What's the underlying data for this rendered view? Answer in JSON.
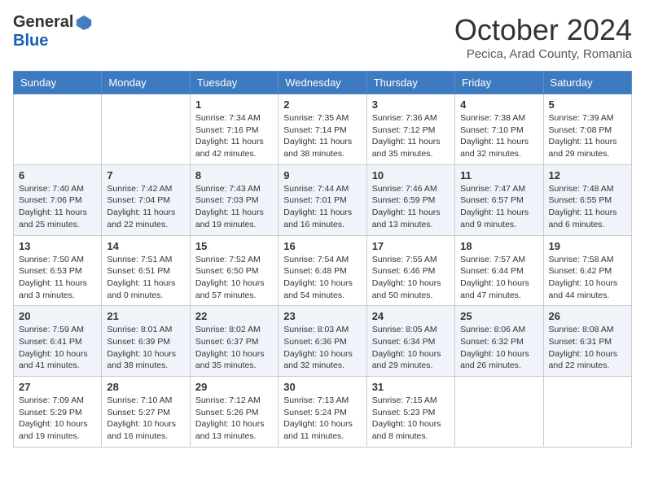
{
  "header": {
    "logo": {
      "general": "General",
      "blue": "Blue"
    },
    "title": "October 2024",
    "subtitle": "Pecica, Arad County, Romania"
  },
  "days_of_week": [
    "Sunday",
    "Monday",
    "Tuesday",
    "Wednesday",
    "Thursday",
    "Friday",
    "Saturday"
  ],
  "weeks": [
    [
      {
        "day": null,
        "sunrise": null,
        "sunset": null,
        "daylight": null
      },
      {
        "day": null,
        "sunrise": null,
        "sunset": null,
        "daylight": null
      },
      {
        "day": "1",
        "sunrise": "Sunrise: 7:34 AM",
        "sunset": "Sunset: 7:16 PM",
        "daylight": "Daylight: 11 hours and 42 minutes."
      },
      {
        "day": "2",
        "sunrise": "Sunrise: 7:35 AM",
        "sunset": "Sunset: 7:14 PM",
        "daylight": "Daylight: 11 hours and 38 minutes."
      },
      {
        "day": "3",
        "sunrise": "Sunrise: 7:36 AM",
        "sunset": "Sunset: 7:12 PM",
        "daylight": "Daylight: 11 hours and 35 minutes."
      },
      {
        "day": "4",
        "sunrise": "Sunrise: 7:38 AM",
        "sunset": "Sunset: 7:10 PM",
        "daylight": "Daylight: 11 hours and 32 minutes."
      },
      {
        "day": "5",
        "sunrise": "Sunrise: 7:39 AM",
        "sunset": "Sunset: 7:08 PM",
        "daylight": "Daylight: 11 hours and 29 minutes."
      }
    ],
    [
      {
        "day": "6",
        "sunrise": "Sunrise: 7:40 AM",
        "sunset": "Sunset: 7:06 PM",
        "daylight": "Daylight: 11 hours and 25 minutes."
      },
      {
        "day": "7",
        "sunrise": "Sunrise: 7:42 AM",
        "sunset": "Sunset: 7:04 PM",
        "daylight": "Daylight: 11 hours and 22 minutes."
      },
      {
        "day": "8",
        "sunrise": "Sunrise: 7:43 AM",
        "sunset": "Sunset: 7:03 PM",
        "daylight": "Daylight: 11 hours and 19 minutes."
      },
      {
        "day": "9",
        "sunrise": "Sunrise: 7:44 AM",
        "sunset": "Sunset: 7:01 PM",
        "daylight": "Daylight: 11 hours and 16 minutes."
      },
      {
        "day": "10",
        "sunrise": "Sunrise: 7:46 AM",
        "sunset": "Sunset: 6:59 PM",
        "daylight": "Daylight: 11 hours and 13 minutes."
      },
      {
        "day": "11",
        "sunrise": "Sunrise: 7:47 AM",
        "sunset": "Sunset: 6:57 PM",
        "daylight": "Daylight: 11 hours and 9 minutes."
      },
      {
        "day": "12",
        "sunrise": "Sunrise: 7:48 AM",
        "sunset": "Sunset: 6:55 PM",
        "daylight": "Daylight: 11 hours and 6 minutes."
      }
    ],
    [
      {
        "day": "13",
        "sunrise": "Sunrise: 7:50 AM",
        "sunset": "Sunset: 6:53 PM",
        "daylight": "Daylight: 11 hours and 3 minutes."
      },
      {
        "day": "14",
        "sunrise": "Sunrise: 7:51 AM",
        "sunset": "Sunset: 6:51 PM",
        "daylight": "Daylight: 11 hours and 0 minutes."
      },
      {
        "day": "15",
        "sunrise": "Sunrise: 7:52 AM",
        "sunset": "Sunset: 6:50 PM",
        "daylight": "Daylight: 10 hours and 57 minutes."
      },
      {
        "day": "16",
        "sunrise": "Sunrise: 7:54 AM",
        "sunset": "Sunset: 6:48 PM",
        "daylight": "Daylight: 10 hours and 54 minutes."
      },
      {
        "day": "17",
        "sunrise": "Sunrise: 7:55 AM",
        "sunset": "Sunset: 6:46 PM",
        "daylight": "Daylight: 10 hours and 50 minutes."
      },
      {
        "day": "18",
        "sunrise": "Sunrise: 7:57 AM",
        "sunset": "Sunset: 6:44 PM",
        "daylight": "Daylight: 10 hours and 47 minutes."
      },
      {
        "day": "19",
        "sunrise": "Sunrise: 7:58 AM",
        "sunset": "Sunset: 6:42 PM",
        "daylight": "Daylight: 10 hours and 44 minutes."
      }
    ],
    [
      {
        "day": "20",
        "sunrise": "Sunrise: 7:59 AM",
        "sunset": "Sunset: 6:41 PM",
        "daylight": "Daylight: 10 hours and 41 minutes."
      },
      {
        "day": "21",
        "sunrise": "Sunrise: 8:01 AM",
        "sunset": "Sunset: 6:39 PM",
        "daylight": "Daylight: 10 hours and 38 minutes."
      },
      {
        "day": "22",
        "sunrise": "Sunrise: 8:02 AM",
        "sunset": "Sunset: 6:37 PM",
        "daylight": "Daylight: 10 hours and 35 minutes."
      },
      {
        "day": "23",
        "sunrise": "Sunrise: 8:03 AM",
        "sunset": "Sunset: 6:36 PM",
        "daylight": "Daylight: 10 hours and 32 minutes."
      },
      {
        "day": "24",
        "sunrise": "Sunrise: 8:05 AM",
        "sunset": "Sunset: 6:34 PM",
        "daylight": "Daylight: 10 hours and 29 minutes."
      },
      {
        "day": "25",
        "sunrise": "Sunrise: 8:06 AM",
        "sunset": "Sunset: 6:32 PM",
        "daylight": "Daylight: 10 hours and 26 minutes."
      },
      {
        "day": "26",
        "sunrise": "Sunrise: 8:08 AM",
        "sunset": "Sunset: 6:31 PM",
        "daylight": "Daylight: 10 hours and 22 minutes."
      }
    ],
    [
      {
        "day": "27",
        "sunrise": "Sunrise: 7:09 AM",
        "sunset": "Sunset: 5:29 PM",
        "daylight": "Daylight: 10 hours and 19 minutes."
      },
      {
        "day": "28",
        "sunrise": "Sunrise: 7:10 AM",
        "sunset": "Sunset: 5:27 PM",
        "daylight": "Daylight: 10 hours and 16 minutes."
      },
      {
        "day": "29",
        "sunrise": "Sunrise: 7:12 AM",
        "sunset": "Sunset: 5:26 PM",
        "daylight": "Daylight: 10 hours and 13 minutes."
      },
      {
        "day": "30",
        "sunrise": "Sunrise: 7:13 AM",
        "sunset": "Sunset: 5:24 PM",
        "daylight": "Daylight: 10 hours and 11 minutes."
      },
      {
        "day": "31",
        "sunrise": "Sunrise: 7:15 AM",
        "sunset": "Sunset: 5:23 PM",
        "daylight": "Daylight: 10 hours and 8 minutes."
      },
      {
        "day": null,
        "sunrise": null,
        "sunset": null,
        "daylight": null
      },
      {
        "day": null,
        "sunrise": null,
        "sunset": null,
        "daylight": null
      }
    ]
  ]
}
